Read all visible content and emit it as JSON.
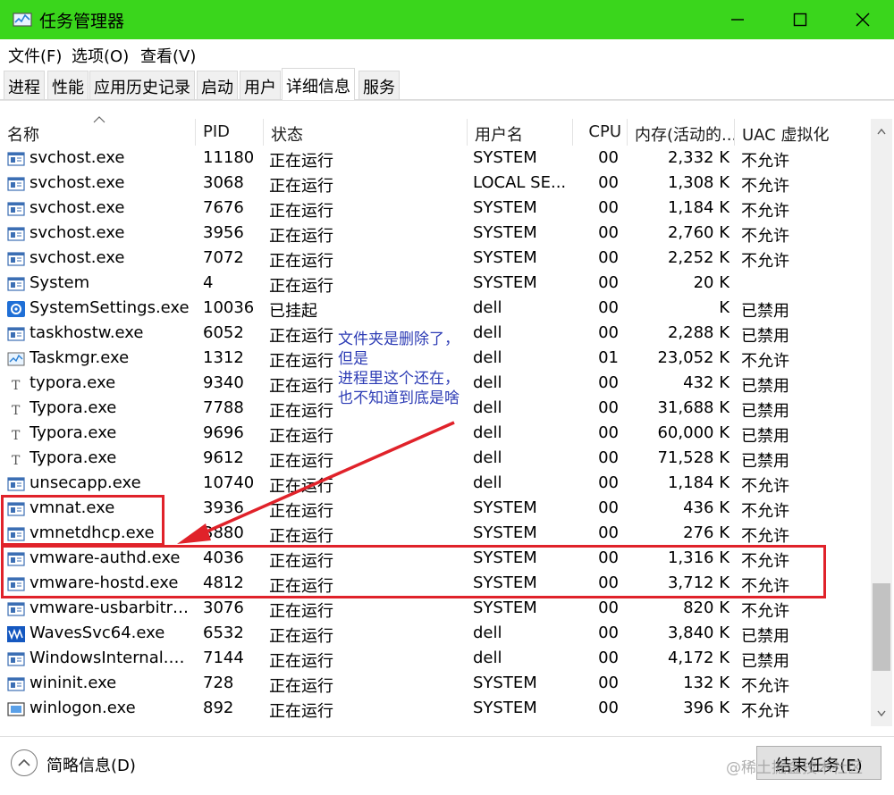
{
  "window": {
    "title": "任务管理器",
    "controls": [
      "minimize-icon",
      "maximize-icon",
      "close-icon"
    ],
    "accent_color": "#3ad61c"
  },
  "menubar": {
    "items": [
      {
        "label": "文件(F)"
      },
      {
        "label": "选项(O)"
      },
      {
        "label": "查看(V)"
      }
    ]
  },
  "tabs": [
    {
      "label": "进程"
    },
    {
      "label": "性能"
    },
    {
      "label": "应用历史记录"
    },
    {
      "label": "启动"
    },
    {
      "label": "用户"
    },
    {
      "label": "详细信息",
      "active": true
    },
    {
      "label": "服务"
    }
  ],
  "table": {
    "columns": [
      "名称",
      "PID",
      "状态",
      "用户名",
      "CPU",
      "内存(活动的...",
      "UAC 虚拟化"
    ],
    "sort_column": "名称",
    "rows": [
      {
        "icon": "process-icon",
        "name": "svchost.exe",
        "pid": "11180",
        "status": "正在运行",
        "user": "SYSTEM",
        "cpu": "00",
        "mem": "2,332 K",
        "uac": "不允许"
      },
      {
        "icon": "process-icon",
        "name": "svchost.exe",
        "pid": "3068",
        "status": "正在运行",
        "user": "LOCAL SE...",
        "cpu": "00",
        "mem": "1,308 K",
        "uac": "不允许"
      },
      {
        "icon": "process-icon",
        "name": "svchost.exe",
        "pid": "7676",
        "status": "正在运行",
        "user": "SYSTEM",
        "cpu": "00",
        "mem": "1,184 K",
        "uac": "不允许"
      },
      {
        "icon": "process-icon",
        "name": "svchost.exe",
        "pid": "3956",
        "status": "正在运行",
        "user": "SYSTEM",
        "cpu": "00",
        "mem": "2,760 K",
        "uac": "不允许"
      },
      {
        "icon": "process-icon",
        "name": "svchost.exe",
        "pid": "7072",
        "status": "正在运行",
        "user": "SYSTEM",
        "cpu": "00",
        "mem": "2,252 K",
        "uac": "不允许"
      },
      {
        "icon": "process-icon",
        "name": "System",
        "pid": "4",
        "status": "正在运行",
        "user": "SYSTEM",
        "cpu": "00",
        "mem": "20 K",
        "uac": ""
      },
      {
        "icon": "gear-icon",
        "name": "SystemSettings.exe",
        "pid": "10036",
        "status": "已挂起",
        "user": "dell",
        "cpu": "00",
        "mem": "K",
        "uac": "已禁用"
      },
      {
        "icon": "process-icon",
        "name": "taskhostw.exe",
        "pid": "6052",
        "status": "正在运行",
        "user": "dell",
        "cpu": "00",
        "mem": "2,288 K",
        "uac": "已禁用"
      },
      {
        "icon": "taskmgr-icon",
        "name": "Taskmgr.exe",
        "pid": "1312",
        "status": "正在运行",
        "user": "dell",
        "cpu": "01",
        "mem": "23,052 K",
        "uac": "不允许"
      },
      {
        "icon": "typora-icon",
        "name": "typora.exe",
        "pid": "9340",
        "status": "正在运行",
        "user": "dell",
        "cpu": "00",
        "mem": "432 K",
        "uac": "已禁用"
      },
      {
        "icon": "typora-icon",
        "name": "Typora.exe",
        "pid": "7788",
        "status": "正在运行",
        "user": "dell",
        "cpu": "00",
        "mem": "31,688 K",
        "uac": "已禁用"
      },
      {
        "icon": "typora-icon",
        "name": "Typora.exe",
        "pid": "9696",
        "status": "正在运行",
        "user": "dell",
        "cpu": "00",
        "mem": "60,000 K",
        "uac": "已禁用"
      },
      {
        "icon": "typora-icon",
        "name": "Typora.exe",
        "pid": "9612",
        "status": "正在运行",
        "user": "dell",
        "cpu": "00",
        "mem": "71,528 K",
        "uac": "已禁用"
      },
      {
        "icon": "process-icon",
        "name": "unsecapp.exe",
        "pid": "10740",
        "status": "正在运行",
        "user": "dell",
        "cpu": "00",
        "mem": "1,184 K",
        "uac": "不允许"
      },
      {
        "icon": "process-icon",
        "name": "vmnat.exe",
        "pid": "3936",
        "status": "正在运行",
        "user": "SYSTEM",
        "cpu": "00",
        "mem": "436 K",
        "uac": "不允许"
      },
      {
        "icon": "process-icon",
        "name": "vmnetdhcp.exe",
        "pid": "3880",
        "status": "正在运行",
        "user": "SYSTEM",
        "cpu": "00",
        "mem": "276 K",
        "uac": "不允许"
      },
      {
        "icon": "process-icon",
        "name": "vmware-authd.exe",
        "pid": "4036",
        "status": "正在运行",
        "user": "SYSTEM",
        "cpu": "00",
        "mem": "1,316 K",
        "uac": "不允许"
      },
      {
        "icon": "process-icon",
        "name": "vmware-hostd.exe",
        "pid": "4812",
        "status": "正在运行",
        "user": "SYSTEM",
        "cpu": "00",
        "mem": "3,712 K",
        "uac": "不允许"
      },
      {
        "icon": "process-icon",
        "name": "vmware-usbarbitrat...",
        "pid": "3076",
        "status": "正在运行",
        "user": "SYSTEM",
        "cpu": "00",
        "mem": "820 K",
        "uac": "不允许"
      },
      {
        "icon": "waves-icon",
        "name": "WavesSvc64.exe",
        "pid": "6532",
        "status": "正在运行",
        "user": "dell",
        "cpu": "00",
        "mem": "3,840 K",
        "uac": "已禁用"
      },
      {
        "icon": "process-icon",
        "name": "WindowsInternal.C...",
        "pid": "7144",
        "status": "正在运行",
        "user": "dell",
        "cpu": "00",
        "mem": "4,172 K",
        "uac": "已禁用"
      },
      {
        "icon": "process-icon",
        "name": "wininit.exe",
        "pid": "728",
        "status": "正在运行",
        "user": "SYSTEM",
        "cpu": "00",
        "mem": "132 K",
        "uac": "不允许"
      },
      {
        "icon": "winlogon-icon",
        "name": "winlogon.exe",
        "pid": "892",
        "status": "正在运行",
        "user": "SYSTEM",
        "cpu": "00",
        "mem": "396 K",
        "uac": "不允许"
      }
    ]
  },
  "annotation": {
    "lines": [
      "文件夹是删除了，",
      "但是",
      "进程里这个还在，",
      "也不知道到底是啥"
    ],
    "color": "#2d3cb5",
    "highlight_color": "#e0222a"
  },
  "footer": {
    "details_label": "简略信息(D)",
    "end_task_label": "结束任务(E)",
    "watermark": "@稀土掘金技术社区"
  }
}
